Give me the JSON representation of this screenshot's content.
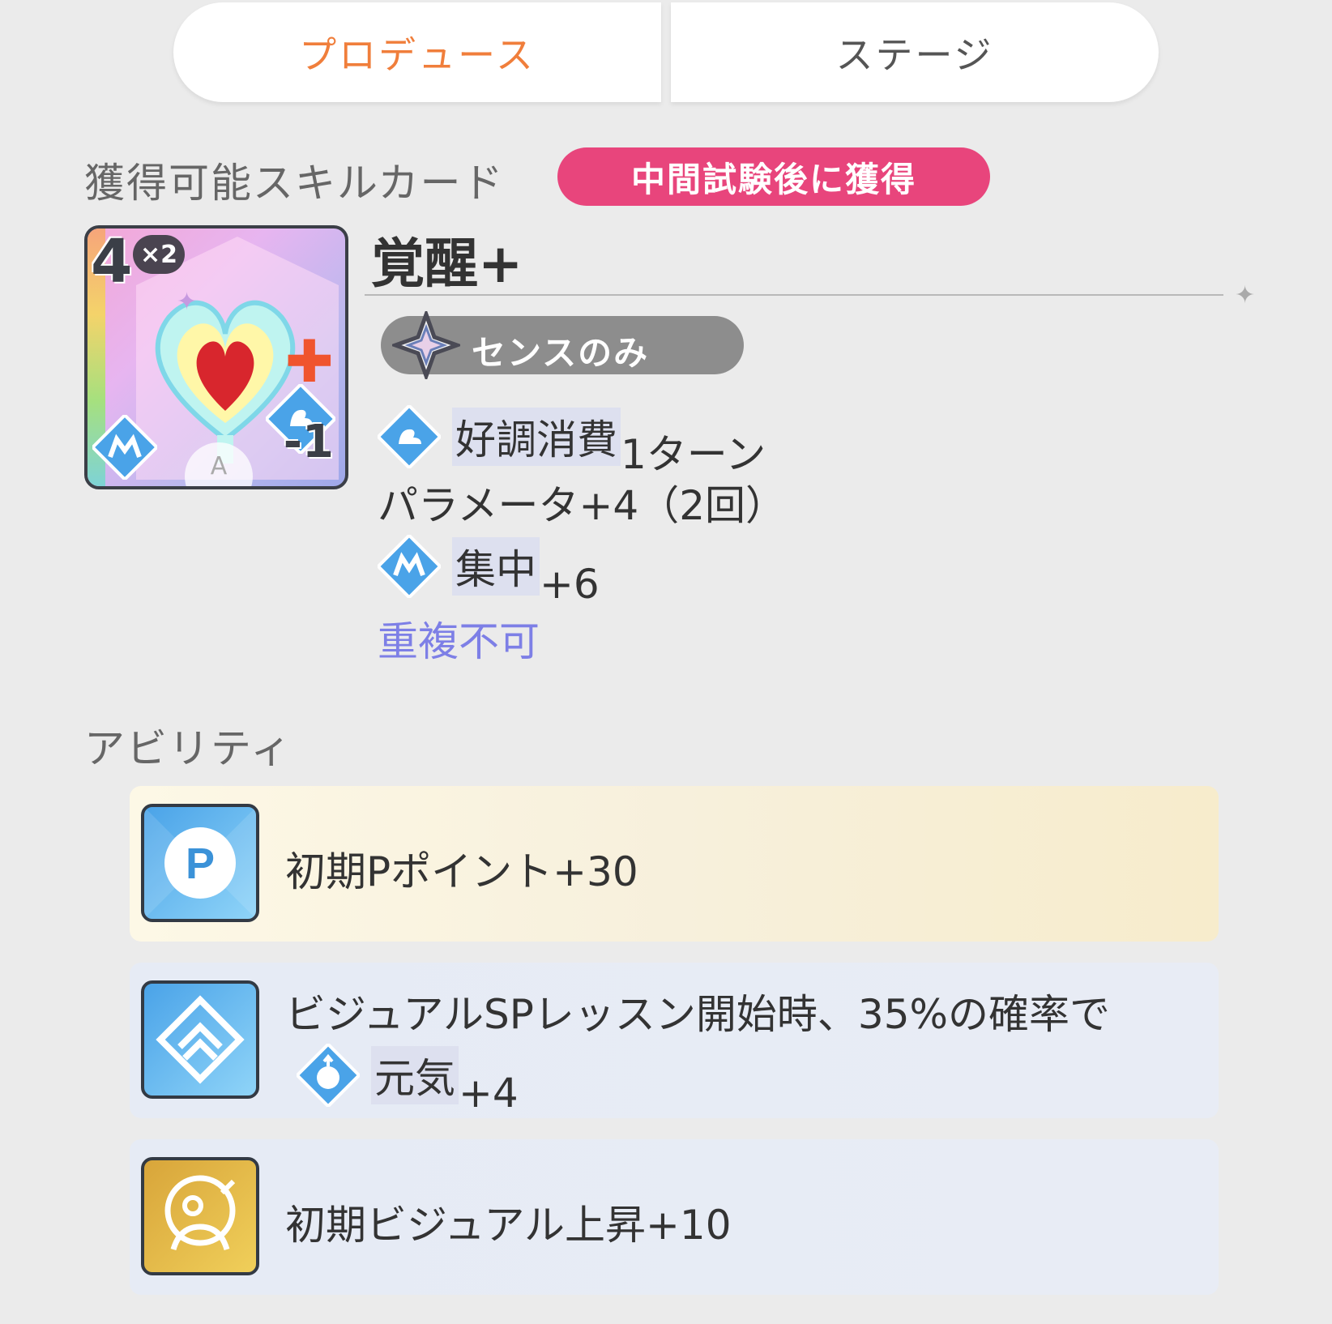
{
  "tabs": {
    "produce": "プロデュース",
    "stage": "ステージ"
  },
  "skill_section": {
    "title": "獲得可能スキルカード",
    "badge": "中間試験後に獲得"
  },
  "card": {
    "cost": "4",
    "times": "×2",
    "cost_change": "-1",
    "grade_mark": "A",
    "name": "覚醒+",
    "restriction": "センスのみ",
    "effects": {
      "line1_tag": "好調消費",
      "line1_rest": "1ターン",
      "line2": "パラメータ+4（2回）",
      "line3_tag": "集中",
      "line3_rest": "+6",
      "line4": "重複不可"
    }
  },
  "ability_section": {
    "title": "アビリティ",
    "items": [
      {
        "text": "初期Pポイント+30",
        "icon": "p-point-icon"
      },
      {
        "text_line1": "ビジュアルSPレッスン開始時、35%の確率で",
        "tag": "元気",
        "rest": "+4",
        "icon": "visual-sp-lesson-icon"
      },
      {
        "text": "初期ビジュアル上昇+10",
        "icon": "visual-growth-icon"
      }
    ]
  },
  "colors": {
    "accent_orange": "#f07e3b",
    "badge_pink": "#e8457c",
    "no_duplicate": "#7d7fe6"
  }
}
